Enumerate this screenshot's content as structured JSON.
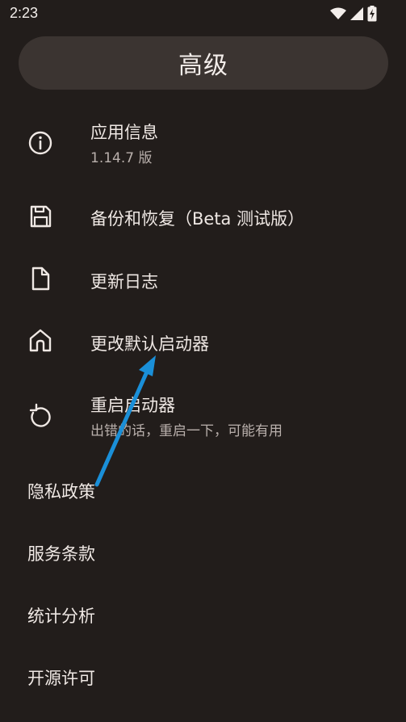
{
  "status_bar": {
    "time": "2:23",
    "icons": [
      "wifi-icon",
      "signal-icon",
      "battery-charging-icon"
    ]
  },
  "header": {
    "title": "高级"
  },
  "settings": {
    "items": [
      {
        "icon": "info-icon",
        "label": "应用信息",
        "subtitle": "1.14.7 版"
      },
      {
        "icon": "save-icon",
        "label": "备份和恢复（Beta 测试版）"
      },
      {
        "icon": "file-icon",
        "label": "更新日志"
      },
      {
        "icon": "home-icon",
        "label": "更改默认启动器"
      },
      {
        "icon": "restart-icon",
        "label": "重启启动器",
        "subtitle": "出错的话，重启一下，可能有用"
      }
    ],
    "plain_items": [
      "隐私政策",
      "服务条款",
      "统计分析",
      "开源许可"
    ]
  },
  "annotation": {
    "color": "#1a8fd8",
    "icon": "arrow-pointer-icon"
  }
}
